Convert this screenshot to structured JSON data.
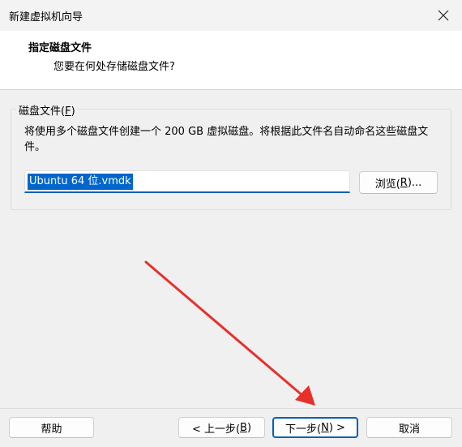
{
  "window": {
    "title": "新建虚拟机向导"
  },
  "header": {
    "title": "指定磁盘文件",
    "subtitle": "您要在何处存储磁盘文件?"
  },
  "disk_group": {
    "legend_text": "磁盘文件(",
    "legend_key": "F",
    "legend_close": ")",
    "description": "将使用多个磁盘文件创建一个 200 GB 虚拟磁盘。将根据此文件名自动命名这些磁盘文件。",
    "filename": "Ubuntu 64 位.vmdk",
    "browse": {
      "pre": "浏览(",
      "key": "R",
      "post": ")..."
    }
  },
  "footer": {
    "help": "帮助",
    "prev": {
      "pre": "< 上一步(",
      "key": "B",
      "post": ")"
    },
    "next": {
      "pre": "下一步(",
      "key": "N",
      "post": ") >"
    },
    "cancel": "取消"
  },
  "colors": {
    "accent": "#005fb8",
    "annotation_arrow": "#e8302b"
  }
}
